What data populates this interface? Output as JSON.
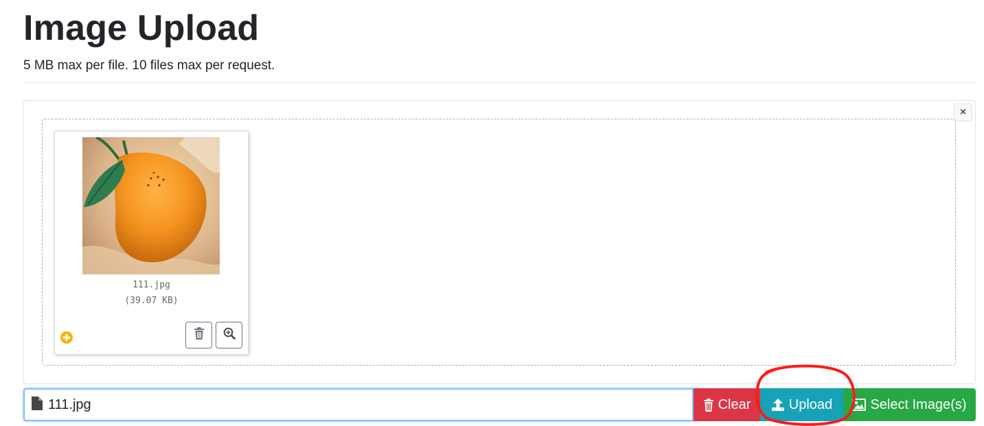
{
  "page": {
    "title": "Image Upload",
    "subtitle": "5 MB max per file. 10 files max per request."
  },
  "preview": {
    "close_label": "×",
    "file": {
      "name": "111.jpg",
      "size": "(39.07 KB)",
      "status_icon": "plus-circle-icon"
    },
    "remove_icon": "trash-icon",
    "zoom_icon": "zoom-in-icon"
  },
  "caption": {
    "icon": "file-icon",
    "value": "111.jpg"
  },
  "actions": {
    "clear_label": "Clear",
    "upload_label": "Upload",
    "select_label": "Select Image(s)"
  },
  "colors": {
    "clear": "#dc3545",
    "upload": "#17a2b8",
    "select": "#28a745",
    "annotation": "#ff1a1a"
  }
}
